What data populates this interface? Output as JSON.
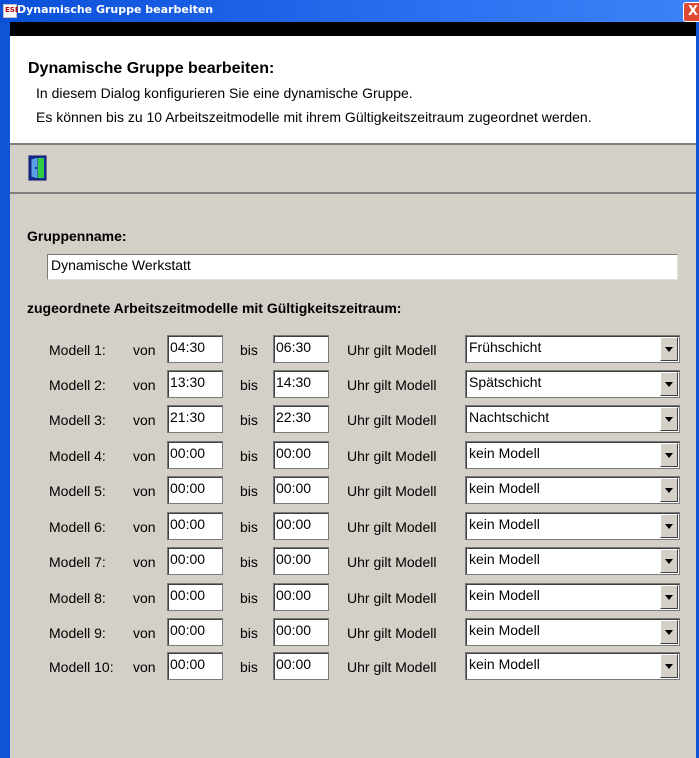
{
  "window": {
    "title": "Dynamische Gruppe bearbeiten",
    "icon_text": "ESB",
    "close_symbol": "X"
  },
  "header": {
    "title": "Dynamische Gruppe bearbeiten:",
    "description_line1": "In diesem Dialog konfigurieren Sie eine dynamische Gruppe.",
    "description_line2": "Es können bis zu 10 Arbeitszeitmodelle mit ihrem Gültigkeitszeitraum zugeordnet werden."
  },
  "toolbar": {
    "exit_icon": "door-exit-icon"
  },
  "form": {
    "group_name_label": "Gruppenname:",
    "group_name_value": "Dynamische Werkstatt",
    "models_label": "zugeordnete Arbeitszeitmodelle mit Gültigkeitszeitraum:",
    "from_label": "von",
    "to_label": "bis",
    "model_suffix_label": "Uhr gilt Modell",
    "models": [
      {
        "label": "Modell 1:",
        "from": "04:30",
        "to": "06:30",
        "model": "Frühschicht"
      },
      {
        "label": "Modell 2:",
        "from": "13:30",
        "to": "14:30",
        "model": "Spätschicht"
      },
      {
        "label": "Modell 3:",
        "from": "21:30",
        "to": "22:30",
        "model": "Nachtschicht"
      },
      {
        "label": "Modell 4:",
        "from": "00:00",
        "to": "00:00",
        "model": "kein Modell"
      },
      {
        "label": "Modell 5:",
        "from": "00:00",
        "to": "00:00",
        "model": "kein Modell"
      },
      {
        "label": "Modell 6:",
        "from": "00:00",
        "to": "00:00",
        "model": "kein Modell"
      },
      {
        "label": "Modell 7:",
        "from": "00:00",
        "to": "00:00",
        "model": "kein Modell"
      },
      {
        "label": "Modell 8:",
        "from": "00:00",
        "to": "00:00",
        "model": "kein Modell"
      },
      {
        "label": "Modell 9:",
        "from": "00:00",
        "to": "00:00",
        "model": "kein Modell"
      },
      {
        "label": "Modell 10:",
        "from": "00:00",
        "to": "00:00",
        "model": "kein Modell"
      }
    ]
  },
  "colors": {
    "titlebar": "#0a4fd8",
    "dialog_bg": "#d4d0c8",
    "header_bg": "#ffffff"
  }
}
